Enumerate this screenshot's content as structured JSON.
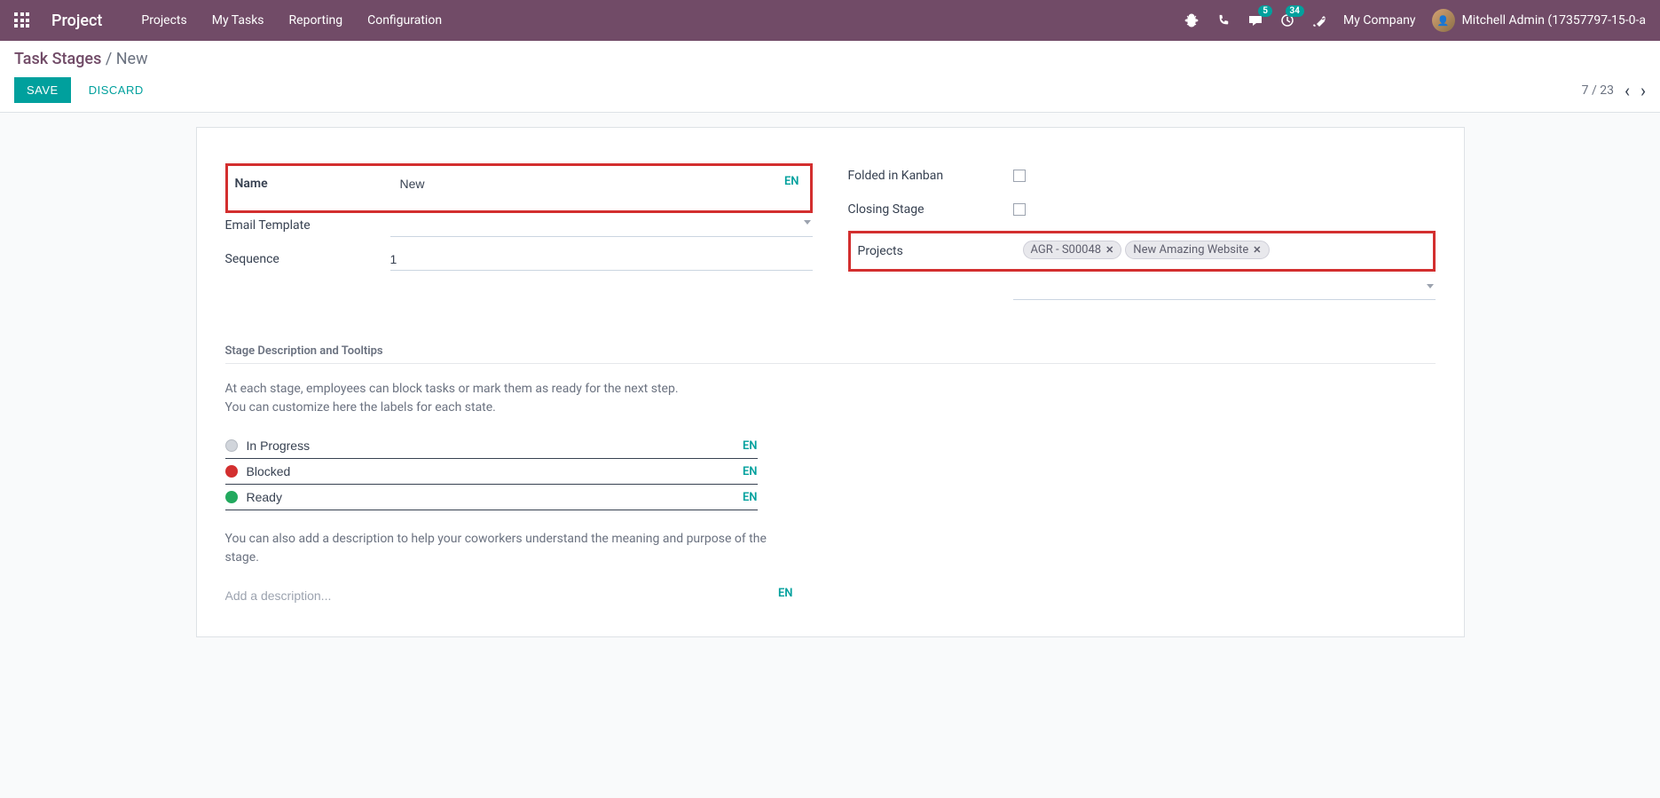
{
  "navbar": {
    "brand": "Project",
    "menu": [
      "Projects",
      "My Tasks",
      "Reporting",
      "Configuration"
    ],
    "messages_badge": "5",
    "activities_badge": "34",
    "company": "My Company",
    "user": "Mitchell Admin (17357797-15-0-a"
  },
  "breadcrumb": {
    "root": "Task Stages",
    "current": "New"
  },
  "actions": {
    "save": "SAVE",
    "discard": "DISCARD",
    "pager": "7 / 23"
  },
  "form": {
    "name_label": "Name",
    "name_value": "New",
    "name_lang": "EN",
    "email_label": "Email Template",
    "email_value": "",
    "seq_label": "Sequence",
    "seq_value": "1",
    "folded_label": "Folded in Kanban",
    "closing_label": "Closing Stage",
    "projects_label": "Projects",
    "project_tags": [
      "AGR - S00048",
      "New Amazing Website"
    ]
  },
  "section": {
    "title": "Stage Description and Tooltips",
    "text1": "At each stage, employees can block tasks or mark them as ready for the next step.",
    "text2": "You can customize here the labels for each state.",
    "states": [
      {
        "label": "In Progress",
        "color": "grey",
        "lang": "EN"
      },
      {
        "label": "Blocked",
        "color": "red",
        "lang": "EN"
      },
      {
        "label": "Ready",
        "color": "green",
        "lang": "EN"
      }
    ],
    "text3": "You can also add a description to help your coworkers understand the meaning and purpose of the stage.",
    "desc_placeholder": "Add a description...",
    "desc_lang": "EN"
  }
}
